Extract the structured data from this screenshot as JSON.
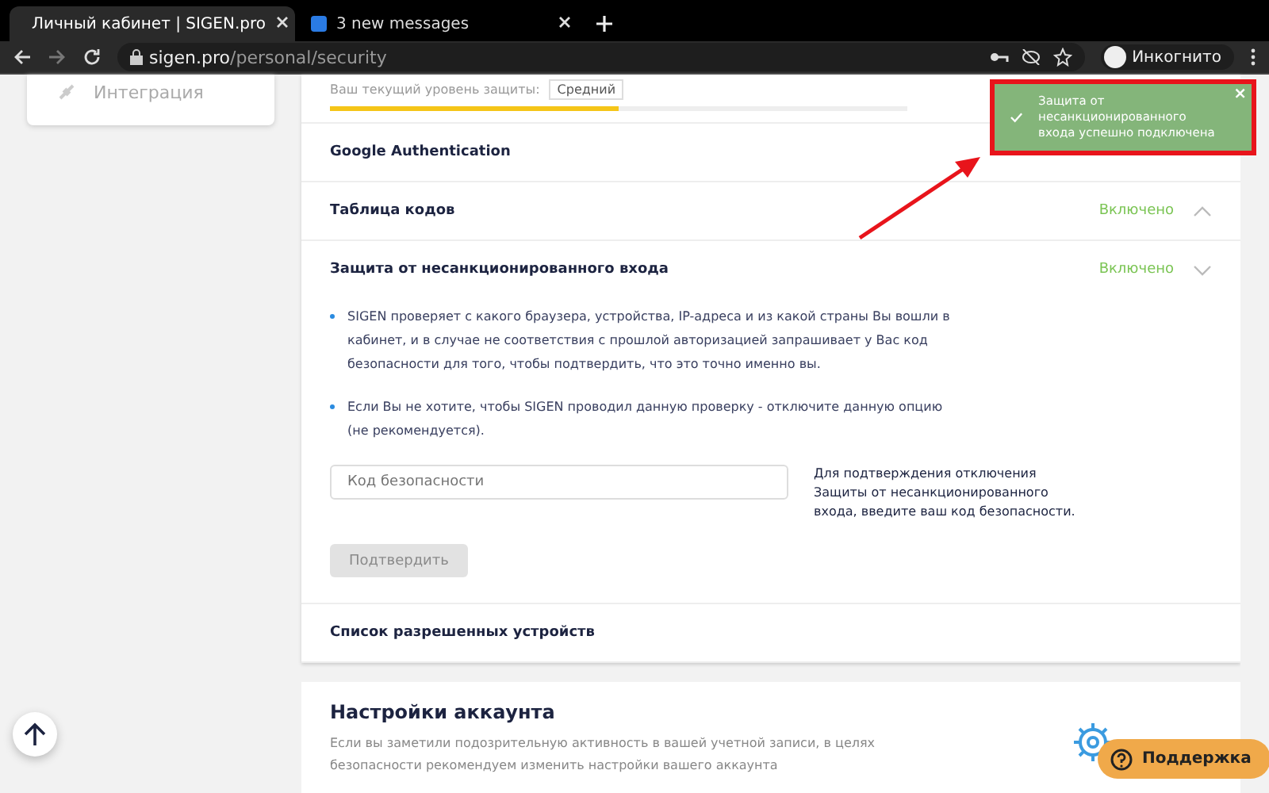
{
  "browser": {
    "tabs": [
      {
        "title": "Личный кабинет | SIGEN.pro",
        "selected": true
      },
      {
        "title": "3 new messages",
        "selected": false
      }
    ],
    "url_host": "sigen.pro",
    "url_path": "/personal/security",
    "profile": "Инкогнито"
  },
  "sidebar": {
    "items": [
      {
        "label": "Интеграция"
      }
    ]
  },
  "security": {
    "level_label": "Ваш текущий уровень защиты:",
    "level_value": "Средний",
    "level": 0.5,
    "sections": [
      {
        "title": "Google Authentication",
        "expanded": false
      },
      {
        "title": "Таблица кодов",
        "status": "Включено",
        "expanded": false
      },
      {
        "title": "Защита от несанкционированного входа",
        "status": "Включено",
        "expanded": true,
        "bullets": [
          "SIGEN проверяет с какого браузера, устройства, IP-адреса и из какой страны Вы вошли в кабинет, и в случае не соответствия с прошлой авторизацией запрашивает у Вас код безопасности для того, чтобы подтвердить, что это точно именно вы.",
          "Если Вы не хотите, чтобы SIGEN проводил данную проверку - отключите данную опцию (не рекомендуется)."
        ],
        "field": {
          "placeholder": "Код безопасности"
        },
        "hint": "Для подтверждения отключения Защиты от несанкционированного входа, введите ваш код безопасности.",
        "button": {
          "label": "Подтвердить",
          "disabled": true
        }
      },
      {
        "title": "Список разрешенных устройств",
        "expanded": false
      }
    ]
  },
  "account": {
    "title": "Настройки аккаунта",
    "text": "Если вы заметили подозрительную активность в вашей учетной записи, в целях безопасности рекомендуем изменить настройки вашего аккаунта"
  },
  "toast": {
    "message": "Защита от несанкционированного входа успешно подключена",
    "close": "×"
  },
  "support": {
    "label": "Поддержка"
  }
}
